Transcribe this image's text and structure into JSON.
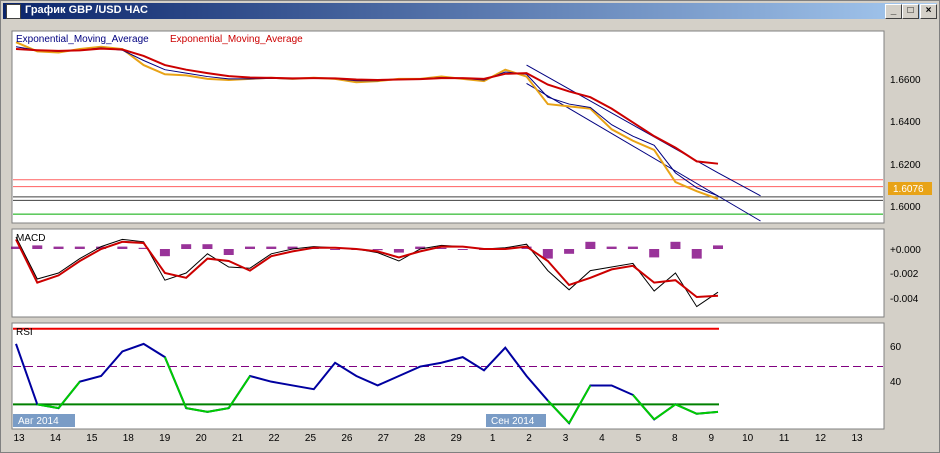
{
  "window": {
    "title": "График GBP /USD ЧАС",
    "minimize": "_",
    "maximize": "□",
    "close": "×"
  },
  "price_panel": {
    "legend": [
      {
        "text": "Exponential_Moving_Average",
        "color": "#000080"
      },
      {
        "text": "Exponential_Moving_Average",
        "color": "#cc0000"
      }
    ],
    "ticks": [
      "1.6600",
      "1.6400",
      "1.6200",
      "1.6000"
    ],
    "last_price": "1.6076"
  },
  "macd_panel": {
    "label": "MACD",
    "ticks": [
      "+0.000",
      "-0.002",
      "-0.004"
    ]
  },
  "rsi_panel": {
    "label": "RSI",
    "ticks": [
      "60",
      "40"
    ]
  },
  "time_axis": {
    "labels": [
      "13",
      "14",
      "15",
      "18",
      "19",
      "20",
      "21",
      "22",
      "25",
      "26",
      "27",
      "28",
      "29",
      "1",
      "2",
      "3",
      "4",
      "5",
      "8",
      "9",
      "10",
      "11",
      "12",
      "13"
    ],
    "month_markers": [
      "Авг 2014",
      "Сен 2014"
    ]
  },
  "colors": {
    "price": "#e8a317",
    "ema_fast": "#000080",
    "ema_slow": "#cc0000",
    "rsi_line": "#0000a0",
    "rsi_low": "#00cc00",
    "histogram": "#800080"
  },
  "chart_data": [
    {
      "type": "line",
      "name": "price",
      "xlabel": "",
      "ylabel": "",
      "x": [
        0,
        1,
        2,
        3,
        4,
        5,
        6,
        7,
        8,
        9,
        10,
        11,
        12,
        13,
        14,
        15,
        16,
        17,
        18,
        19,
        20,
        21,
        22,
        23,
        24,
        25,
        26,
        27,
        28,
        29,
        30,
        31,
        32,
        33
      ],
      "series": [
        {
          "values": [
            1.676,
            1.672,
            1.6715,
            1.673,
            1.674,
            1.673,
            1.666,
            1.662,
            1.6615,
            1.66,
            1.6595,
            1.66,
            1.6605,
            1.66,
            1.6605,
            1.66,
            1.6585,
            1.659,
            1.66,
            1.66,
            1.661,
            1.66,
            1.659,
            1.664,
            1.661,
            1.649,
            1.648,
            1.647,
            1.638,
            1.633,
            1.629,
            1.615,
            1.611,
            1.6076
          ]
        },
        {
          "values": [
            1.674,
            1.6725,
            1.672,
            1.6725,
            1.6735,
            1.6725,
            1.668,
            1.664,
            1.6625,
            1.661,
            1.66,
            1.66,
            1.6602,
            1.66,
            1.6603,
            1.6601,
            1.6592,
            1.6592,
            1.6598,
            1.66,
            1.6606,
            1.6602,
            1.6595,
            1.663,
            1.662,
            1.652,
            1.649,
            1.6475,
            1.64,
            1.635,
            1.631,
            1.619,
            1.6125,
            1.609
          ]
        },
        {
          "values": [
            1.673,
            1.6725,
            1.6722,
            1.6724,
            1.6732,
            1.6728,
            1.67,
            1.666,
            1.664,
            1.6625,
            1.6612,
            1.6606,
            1.6604,
            1.6602,
            1.6603,
            1.6602,
            1.6597,
            1.6595,
            1.6597,
            1.6599,
            1.6603,
            1.6603,
            1.66,
            1.6622,
            1.6625,
            1.6575,
            1.6545,
            1.652,
            1.647,
            1.641,
            1.635,
            1.63,
            1.624,
            1.623
          ]
        }
      ],
      "ylim": [
        1.598,
        1.68
      ],
      "horizontal_levels": [
        1.616,
        1.613,
        1.6085,
        1.607,
        1.601
      ],
      "channel_upper": [
        [
          24,
          1.666
        ],
        [
          33.0,
          1.619
        ],
        [
          35.0,
          1.609
        ]
      ],
      "channel_lower": [
        [
          24,
          1.658
        ],
        [
          35.0,
          1.598
        ]
      ]
    },
    {
      "type": "line",
      "name": "MACD",
      "xlabel": "",
      "ylabel": "",
      "x": [
        0,
        1,
        2,
        3,
        4,
        5,
        6,
        7,
        8,
        9,
        10,
        11,
        12,
        13,
        14,
        15,
        16,
        17,
        18,
        19,
        20,
        21,
        22,
        23,
        24,
        25,
        26,
        27,
        28,
        29,
        30,
        31,
        32,
        33
      ],
      "series": [
        {
          "values": [
            0.001,
            -0.0025,
            -0.002,
            -0.0008,
            0.0002,
            0.0008,
            0.0006,
            -0.0026,
            -0.002,
            -0.0004,
            -0.0015,
            -0.0016,
            -0.0004,
            0.0,
            0.0002,
            0.0001,
            0.0,
            -0.0003,
            -0.001,
            0.0,
            0.0003,
            0.0002,
            0.0,
            0.0001,
            0.0004,
            -0.0018,
            -0.0034,
            -0.0018,
            -0.0015,
            -0.0012,
            -0.0035,
            -0.002,
            -0.0048,
            -0.0036
          ]
        },
        {
          "values": [
            0.0008,
            -0.0028,
            -0.0022,
            -0.001,
            0.0,
            0.0006,
            0.0005,
            -0.002,
            -0.0024,
            -0.0008,
            -0.001,
            -0.0018,
            -0.0006,
            -0.0002,
            0.0001,
            0.0001,
            0.0,
            -0.0002,
            -0.0007,
            -0.0002,
            0.0002,
            0.0002,
            0.0,
            0.0,
            0.0002,
            -0.001,
            -0.003,
            -0.0024,
            -0.0017,
            -0.0014,
            -0.0028,
            -0.0026,
            -0.004,
            -0.0039
          ]
        }
      ],
      "histogram": [
        0.0002,
        0.0003,
        0.0002,
        0.0002,
        0.0002,
        0.0002,
        0.0001,
        -0.0006,
        0.0004,
        0.0004,
        -0.0005,
        0.0002,
        0.0002,
        0.0002,
        0.0001,
        0.0,
        0.0,
        -0.0001,
        -0.0003,
        0.0002,
        0.0001,
        0.0,
        0.0,
        0.0001,
        0.0002,
        -0.0008,
        -0.0004,
        0.0006,
        0.0002,
        0.0002,
        -0.0007,
        0.0006,
        -0.0008,
        0.0003
      ],
      "ylim": [
        -0.0055,
        0.0015
      ]
    },
    {
      "type": "line",
      "name": "RSI",
      "xlabel": "",
      "ylabel": "",
      "x": [
        0,
        1,
        2,
        3,
        4,
        5,
        6,
        7,
        8,
        9,
        10,
        11,
        12,
        13,
        14,
        15,
        16,
        17,
        18,
        19,
        20,
        21,
        22,
        23,
        24,
        25,
        26,
        27,
        28,
        29,
        30,
        31,
        32,
        33
      ],
      "series": [
        {
          "values": [
            62,
            30,
            28,
            42,
            45,
            58,
            62,
            55,
            28,
            26,
            28,
            45,
            42,
            40,
            38,
            52,
            45,
            40,
            45,
            50,
            52,
            55,
            48,
            60,
            45,
            32,
            20,
            40,
            40,
            35,
            22,
            30,
            25,
            26
          ]
        }
      ],
      "levels": [
        70,
        30
      ],
      "midline": 50,
      "ylim": [
        18,
        72
      ]
    }
  ]
}
